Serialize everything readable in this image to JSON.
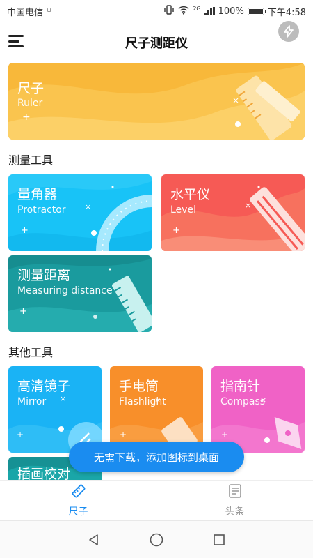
{
  "status_bar": {
    "carrier": "中国电信",
    "battery": "100%",
    "time": "下午4:58",
    "network": "2G"
  },
  "app_bar": {
    "title": "尺子测距仪"
  },
  "hero": {
    "title": "尺子",
    "subtitle": "Ruler",
    "color": "#f8b83a"
  },
  "sections": {
    "measure": "测量工具",
    "other": "其他工具"
  },
  "measure_tools": [
    {
      "title": "量角器",
      "subtitle": "Protractor",
      "color": "#18c3f7"
    },
    {
      "title": "水平仪",
      "subtitle": "Level",
      "color": "#f65a55"
    },
    {
      "title": "测量距离",
      "subtitle": "Measuring distance",
      "color": "#1a9b9e"
    }
  ],
  "other_tools": [
    {
      "title": "高清镜子",
      "subtitle": "Mirror",
      "color": "#1ab3f5"
    },
    {
      "title": "手电筒",
      "subtitle": "Flashlight",
      "color": "#f88f2a"
    },
    {
      "title": "指南针",
      "subtitle": "Compass",
      "color": "#f062c6"
    },
    {
      "title": "插画校对",
      "subtitle": "",
      "color": "#1aa6a8"
    }
  ],
  "toast": {
    "text": "无需下载，添加图标到桌面"
  },
  "bottom_nav": [
    {
      "label": "尺子",
      "icon": "ruler-icon",
      "active": true
    },
    {
      "label": "头条",
      "icon": "news-icon",
      "active": false
    }
  ],
  "colors": {
    "accent": "#1a8cf0"
  }
}
